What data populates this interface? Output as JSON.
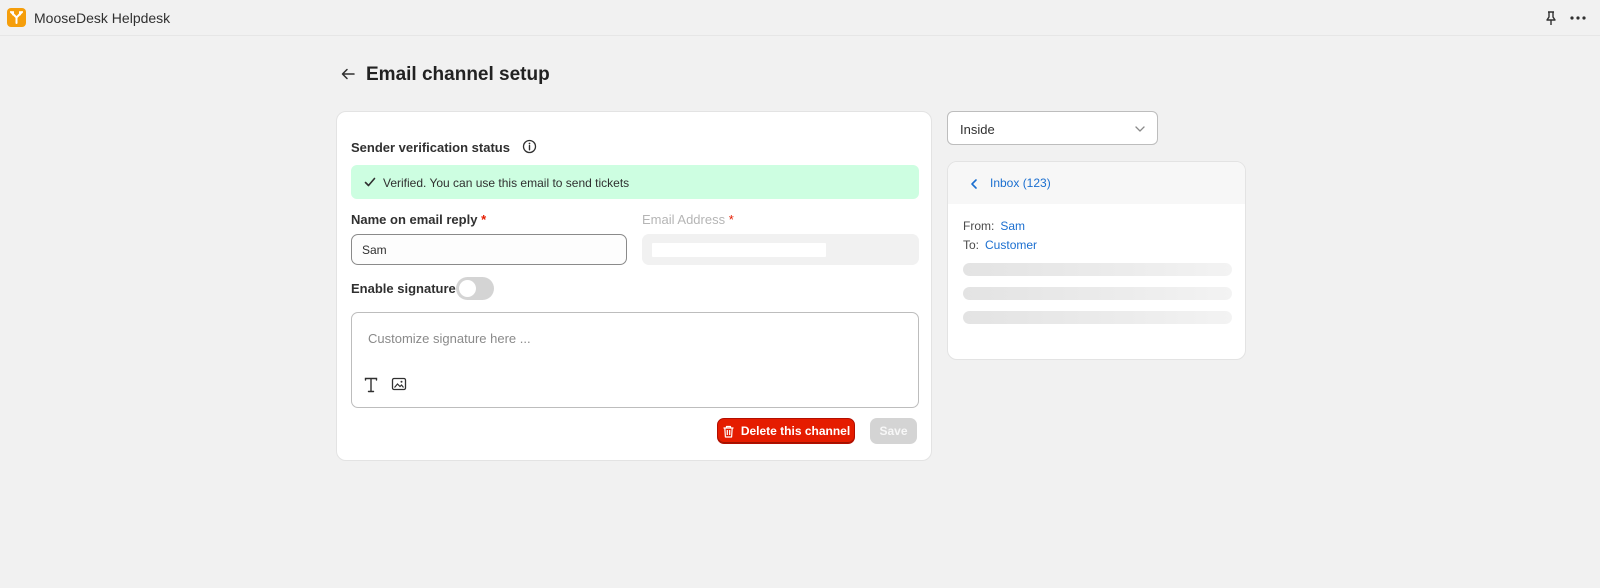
{
  "app": {
    "title": "MooseDesk Helpdesk",
    "accent": "#f59e0b",
    "icons": [
      "app-logo-icon",
      "pin-icon",
      "more-icon"
    ]
  },
  "page": {
    "title": "Email channel setup"
  },
  "sender_verification": {
    "title": "Sender verification status",
    "status_text": "Verified. You can use this email to send tickets",
    "status_color": "#cdfee1"
  },
  "form": {
    "name_label": "Name on email reply",
    "required_mark": "*",
    "name_value": "Sam",
    "email_label": "Email Address",
    "signature_label": "Enable signature",
    "signature_enabled": false,
    "signature_placeholder": "Customize signature here ..."
  },
  "actions": {
    "delete_label": "Delete this channel",
    "save_label": "Save",
    "danger_color": "#e51c00"
  },
  "preview": {
    "mode": "Inside",
    "inbox_label": "Inbox (123)",
    "from_label": "From:",
    "from_value": "Sam",
    "to_label": "To:",
    "to_value": "Customer"
  }
}
